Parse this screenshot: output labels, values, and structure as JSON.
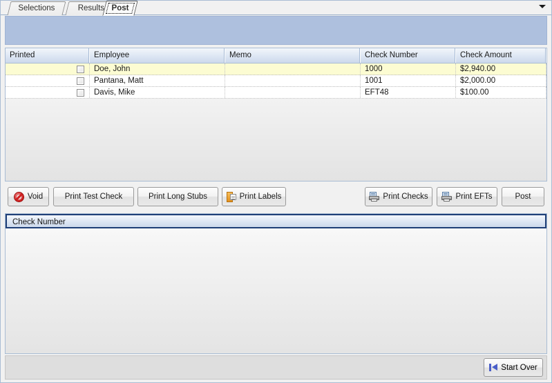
{
  "tabs": [
    {
      "label": "Selections",
      "active": false
    },
    {
      "label": "Results",
      "active": false
    },
    {
      "label": "Post",
      "active": true
    }
  ],
  "tabstrip": {
    "menu_icon": "chevron-down-icon"
  },
  "grid": {
    "columns": [
      "Printed",
      "Employee",
      "Memo",
      "Check Number",
      "Check Amount"
    ],
    "rows": [
      {
        "printed": false,
        "employee": "Doe, John",
        "memo": "",
        "check_number": "1000",
        "check_amount": "$2,940.00",
        "selected": true
      },
      {
        "printed": false,
        "employee": "Pantana, Matt",
        "memo": "",
        "check_number": "1001",
        "check_amount": "$2,000.00",
        "selected": false
      },
      {
        "printed": false,
        "employee": "Davis, Mike",
        "memo": "",
        "check_number": "EFT48",
        "check_amount": "$100.00",
        "selected": false
      }
    ]
  },
  "buttons": {
    "void": {
      "label": "Void",
      "icon": "void-icon"
    },
    "print_test_check": {
      "label": "Print Test Check"
    },
    "print_long_stubs": {
      "label": "Print Long Stubs"
    },
    "print_labels": {
      "label": "Print Labels",
      "icon": "label-icon"
    },
    "print_checks": {
      "label": "Print Checks",
      "icon": "printer-icon"
    },
    "print_efts": {
      "label": "Print EFTs",
      "icon": "printer-icon"
    },
    "post": {
      "label": "Post"
    }
  },
  "lower_panel": {
    "column_header": "Check Number",
    "rows": []
  },
  "footer": {
    "start_over": {
      "label": "Start Over",
      "icon": "skip-to-start-icon"
    }
  },
  "colors": {
    "banner": "#aec0de",
    "selected_row": "#fcfcd2",
    "header_border": "#1f3f77",
    "accent_blue": "#4b5fc8",
    "void_red": "#cf1f1f",
    "label_orange": "#e4901c"
  }
}
